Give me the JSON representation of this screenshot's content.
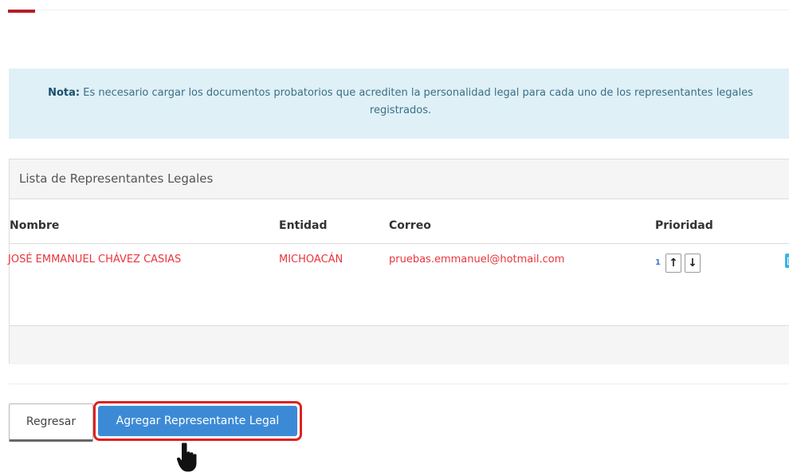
{
  "note": {
    "label": "Nota:",
    "text": "Es necesario cargar los documentos probatorios que acrediten la personalidad legal para cada uno de los representantes legales registrados."
  },
  "panel": {
    "title": "Lista de Representantes Legales",
    "columns": {
      "nombre": "Nombre",
      "entidad": "Entidad",
      "correo": "Correo",
      "prioridad": "Prioridad"
    },
    "rows": [
      {
        "nombre": "JOSÉ EMMANUEL CHÁVEZ CASIAS",
        "entidad": "MICHOACÁN",
        "correo": "pruebas.emmanuel@hotmail.com",
        "prioridad": "1",
        "up_icon": "arrow-up-icon",
        "down_icon": "arrow-down-icon",
        "edit_icon": "edit-icon"
      }
    ]
  },
  "buttons": {
    "back": "Regresar",
    "add": "Agregar Representante Legal"
  },
  "colors": {
    "accent_red": "#b41e2a",
    "row_text": "#e8353b",
    "primary_blue": "#3c8ad6",
    "info_bg": "#dff0f7",
    "highlight_outline": "#e0201f"
  },
  "cursor": "hand-pointer-icon"
}
